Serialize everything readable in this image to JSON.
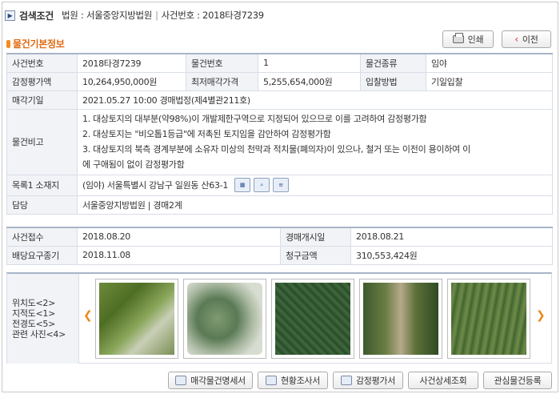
{
  "search": {
    "title": "검색조건",
    "court_label": "법원 : 서울중앙지방법원",
    "case_label": "사건번호 : 2018타경7239"
  },
  "section": {
    "title": "물건기본정보"
  },
  "buttons": {
    "print": "인쇄",
    "prev": "이전"
  },
  "basic": {
    "case_no_label": "사건번호",
    "case_no": "2018타경7239",
    "item_no_label": "물건번호",
    "item_no": "1",
    "item_type_label": "물건종류",
    "item_type": "임야",
    "appraisal_label": "감정평가액",
    "appraisal": "10,264,950,000원",
    "min_price_label": "최저매각가격",
    "min_price": "5,255,654,000원",
    "bid_method_label": "입찰방법",
    "bid_method": "기일입찰",
    "sale_date_label": "매각기일",
    "sale_date": "2021.05.27 10:00 경매법정(제4별관211호)",
    "note_label": "물건비고",
    "notes": [
      "1. 대상토지의 대부분(약98%)이 개발제한구역으로 지정되어 있으므로 이를 고려하여 감정평가함",
      "2. 대상토지는 \"비오톱1등급\"에 저촉된 토지임을 감안하여 감정평가함",
      "3. 대상토지의 북측 경계부분에 소유자 미상의 천막과 적치물(폐의자)이 있으나, 철거 또는 이전이 용이하여 이",
      "에 구애됨이 없이 감정평가함"
    ],
    "address_label": "목록1 소재지",
    "address": "(임야) 서울특별시 강남구 일원동 산63-1",
    "charge_label": "담당",
    "charge": "서울중앙지방법원 | 경매2계"
  },
  "schedule": {
    "received_label": "사건접수",
    "received": "2018.08.20",
    "start_label": "경매개시일",
    "start": "2018.08.21",
    "deadline_label": "배당요구종기",
    "deadline": "2018.11.08",
    "claim_label": "청구금액",
    "claim": "310,553,424원"
  },
  "photos": {
    "labels": [
      "위치도<2>",
      "지적도<1>",
      "전경도<5>",
      "관련 사진<4>"
    ]
  },
  "bottom": {
    "spec": "매각물건명세서",
    "survey": "현황조사서",
    "appraisal_doc": "감정평가서",
    "case_detail": "사건상세조회",
    "watch": "관심물건등록"
  }
}
